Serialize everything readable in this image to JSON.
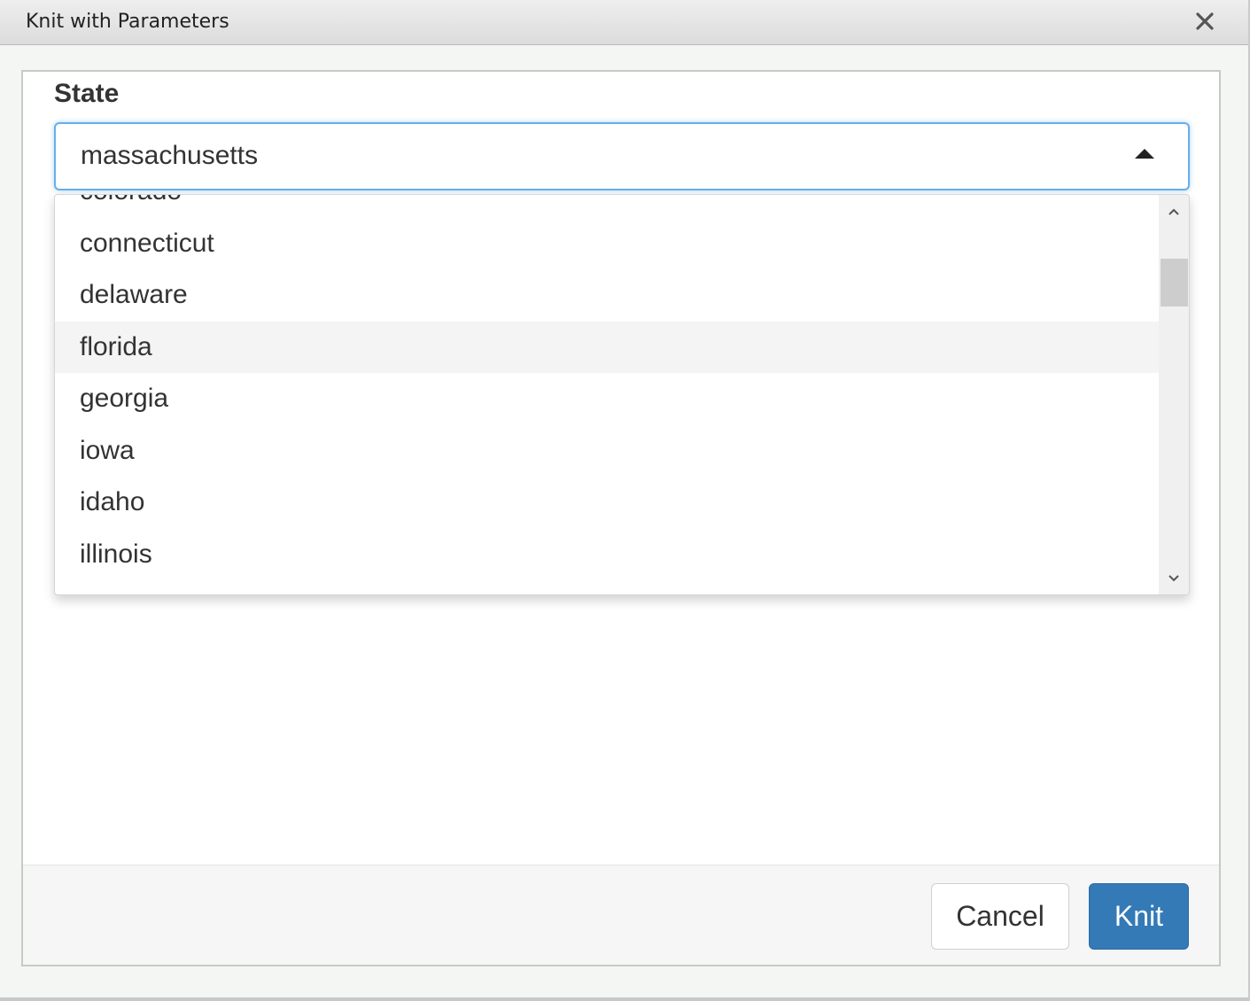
{
  "window": {
    "title": "Knit with Parameters",
    "close_icon": "close-icon"
  },
  "form": {
    "state_label": "State",
    "state_selected": "massachusetts"
  },
  "dropdown": {
    "options": [
      "colorado",
      "connecticut",
      "delaware",
      "florida",
      "georgia",
      "iowa",
      "idaho",
      "illinois"
    ],
    "hovered": "florida"
  },
  "footer": {
    "cancel_label": "Cancel",
    "knit_label": "Knit"
  },
  "colors": {
    "primary": "#337ab7",
    "focus": "#66afe9"
  }
}
